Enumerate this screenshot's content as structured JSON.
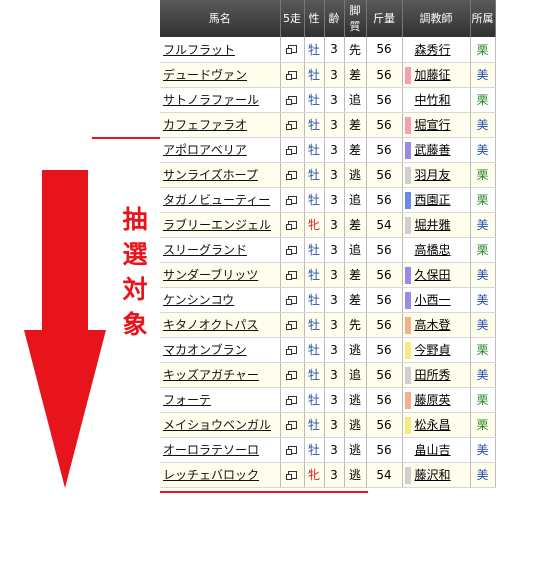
{
  "header": {
    "name": "馬名",
    "fivestart": "5走",
    "sex": "性",
    "age": "齢",
    "style": "脚質",
    "weight": "斤量",
    "trainer": "調教師",
    "affiliation": "所属"
  },
  "annotation": {
    "label": "抽選対象"
  },
  "colors": {
    "accent_red": "#e8141b",
    "miho": "#2a8a2a",
    "ritto": "#2050b0"
  },
  "rows": [
    {
      "name": "フルフラット",
      "sex": "牡",
      "age": "3",
      "style": "先",
      "weight": "56",
      "trainer": "森秀行",
      "aff": "栗",
      "barColor": ""
    },
    {
      "name": "デュードヴァン",
      "sex": "牡",
      "age": "3",
      "style": "差",
      "weight": "56",
      "trainer": "加藤征",
      "aff": "美",
      "barColor": "#f4a0b4"
    },
    {
      "name": "サトノラファール",
      "sex": "牡",
      "age": "3",
      "style": "追",
      "weight": "56",
      "trainer": "中竹和",
      "aff": "栗",
      "barColor": ""
    },
    {
      "name": "カフェファラオ",
      "sex": "牡",
      "age": "3",
      "style": "差",
      "weight": "56",
      "trainer": "堀宣行",
      "aff": "美",
      "barColor": "#f4a0b4"
    },
    {
      "name": "アポロアベリア",
      "sex": "牡",
      "age": "3",
      "style": "差",
      "weight": "56",
      "trainer": "武藤善",
      "aff": "美",
      "barColor": "#9a8ae8"
    },
    {
      "name": "サンライズホープ",
      "sex": "牡",
      "age": "3",
      "style": "逃",
      "weight": "56",
      "trainer": "羽月友",
      "aff": "栗",
      "barColor": "#cfcfcf"
    },
    {
      "name": "タガノビューティー",
      "sex": "牡",
      "age": "3",
      "style": "追",
      "weight": "56",
      "trainer": "西園正",
      "aff": "栗",
      "barColor": "#6a8ae8"
    },
    {
      "name": "ラブリーエンジェル",
      "sex": "牝",
      "age": "3",
      "style": "差",
      "weight": "54",
      "trainer": "堀井雅",
      "aff": "美",
      "barColor": "#cfcfcf"
    },
    {
      "name": "スリーグランド",
      "sex": "牡",
      "age": "3",
      "style": "追",
      "weight": "56",
      "trainer": "高橋忠",
      "aff": "栗",
      "barColor": ""
    },
    {
      "name": "サンダーブリッツ",
      "sex": "牡",
      "age": "3",
      "style": "差",
      "weight": "56",
      "trainer": "久保田",
      "aff": "美",
      "barColor": "#9a8ae8"
    },
    {
      "name": "ケンシンコウ",
      "sex": "牡",
      "age": "3",
      "style": "差",
      "weight": "56",
      "trainer": "小西一",
      "aff": "美",
      "barColor": "#9a8ae8"
    },
    {
      "name": "キタノオクトパス",
      "sex": "牡",
      "age": "3",
      "style": "先",
      "weight": "56",
      "trainer": "高木登",
      "aff": "美",
      "barColor": "#f4b08a"
    },
    {
      "name": "マカオンブラン",
      "sex": "牡",
      "age": "3",
      "style": "逃",
      "weight": "56",
      "trainer": "今野貞",
      "aff": "栗",
      "barColor": "#f4ec80"
    },
    {
      "name": "キッズアガチャー",
      "sex": "牡",
      "age": "3",
      "style": "追",
      "weight": "56",
      "trainer": "田所秀",
      "aff": "美",
      "barColor": "#cfcfcf"
    },
    {
      "name": "フォーテ",
      "sex": "牡",
      "age": "3",
      "style": "逃",
      "weight": "56",
      "trainer": "藤原英",
      "aff": "栗",
      "barColor": "#f4b08a"
    },
    {
      "name": "メイショウベンガル",
      "sex": "牡",
      "age": "3",
      "style": "逃",
      "weight": "56",
      "trainer": "松永昌",
      "aff": "栗",
      "barColor": "#f4ec80"
    },
    {
      "name": "オーロラテソーロ",
      "sex": "牡",
      "age": "3",
      "style": "逃",
      "weight": "56",
      "trainer": "畠山吉",
      "aff": "美",
      "barColor": ""
    },
    {
      "name": "レッチェバロック",
      "sex": "牝",
      "age": "3",
      "style": "逃",
      "weight": "54",
      "trainer": "藤沢和",
      "aff": "美",
      "barColor": "#cfcfcf"
    }
  ]
}
